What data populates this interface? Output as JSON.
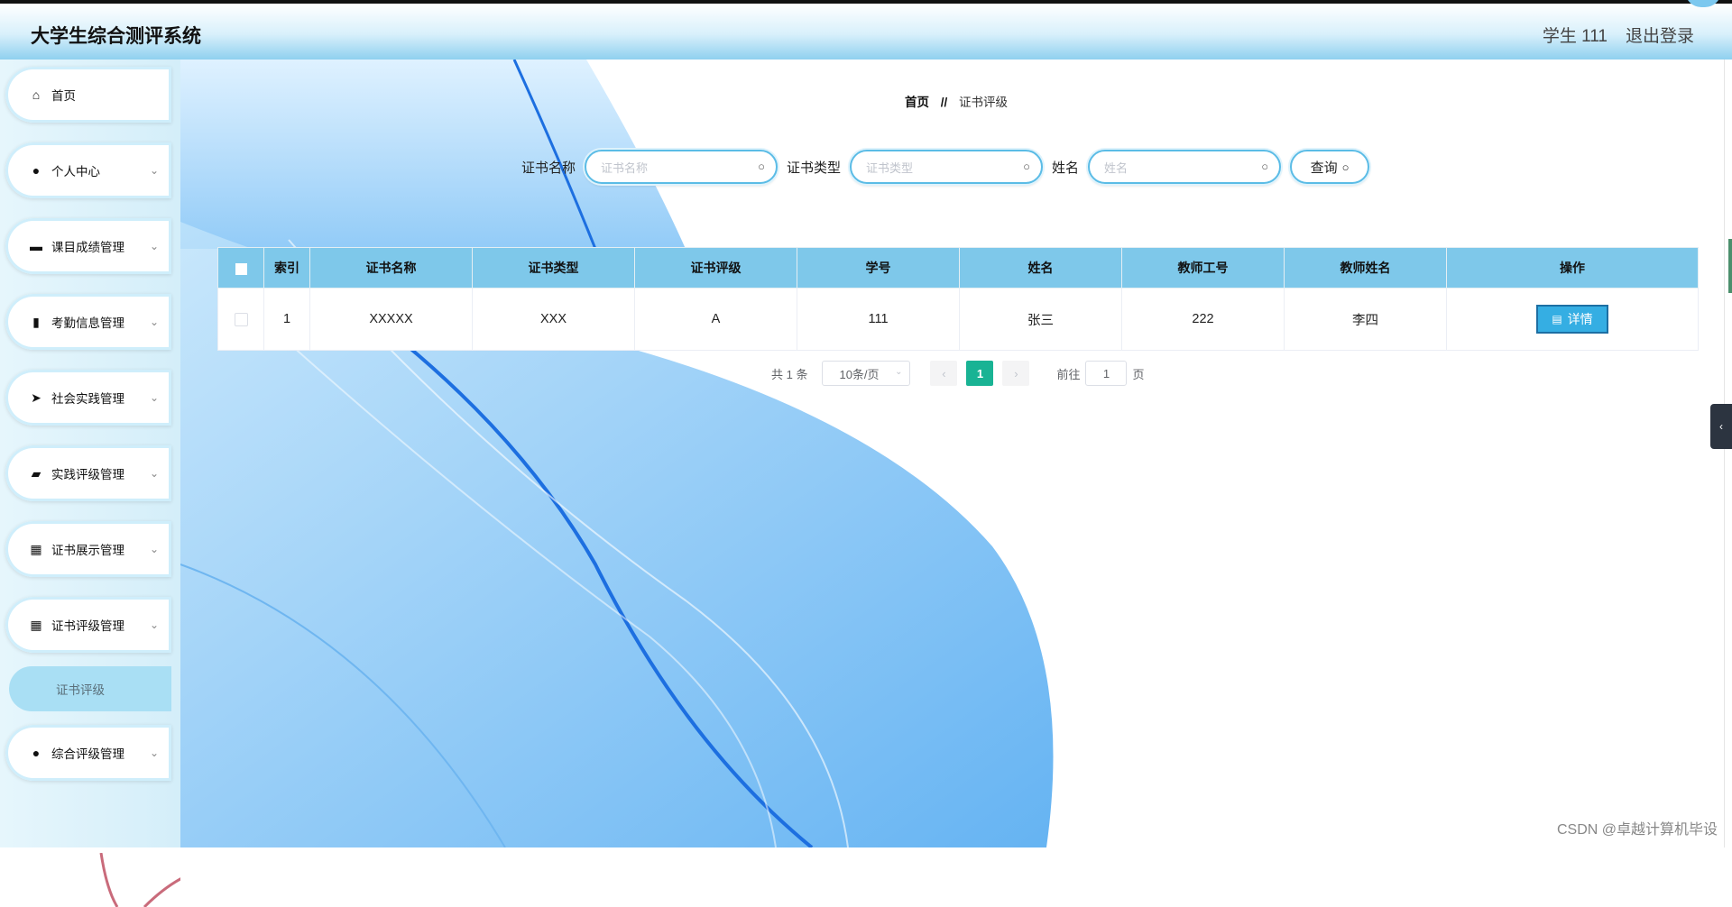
{
  "header": {
    "title": "大学生综合测评系统",
    "user": "学生 111",
    "logout": "退出登录"
  },
  "sidebar": {
    "items": [
      {
        "label": "首页",
        "icon": "home-icon",
        "glyph": "⌂",
        "has_arrow": false
      },
      {
        "label": "个人中心",
        "icon": "user-icon",
        "glyph": "●",
        "has_arrow": true
      },
      {
        "label": "课目成绩管理",
        "icon": "monitor-icon",
        "glyph": "▬",
        "has_arrow": true
      },
      {
        "label": "考勤信息管理",
        "icon": "clipboard-icon",
        "glyph": "▮",
        "has_arrow": true
      },
      {
        "label": "社会实践管理",
        "icon": "send-icon",
        "glyph": "➤",
        "has_arrow": true
      },
      {
        "label": "实践评级管理",
        "icon": "briefcase-icon",
        "glyph": "▰",
        "has_arrow": true
      },
      {
        "label": "证书展示管理",
        "icon": "grid-icon",
        "glyph": "▦",
        "has_arrow": true
      },
      {
        "label": "证书评级管理",
        "icon": "grid-icon",
        "glyph": "▦",
        "has_arrow": true
      },
      {
        "label": "综合评级管理",
        "icon": "bulb-icon",
        "glyph": "●",
        "has_arrow": true
      }
    ],
    "submenu_active": "证书评级",
    "collapse_arrow": "⌄"
  },
  "breadcrumb": {
    "home": "首页",
    "sep": "//",
    "current": "证书评级"
  },
  "search": {
    "fields": [
      {
        "label": "证书名称",
        "placeholder": "证书名称"
      },
      {
        "label": "证书类型",
        "placeholder": "证书类型"
      },
      {
        "label": "姓名",
        "placeholder": "姓名"
      }
    ],
    "button": "查询",
    "icon_glyph": "○"
  },
  "table": {
    "headers": [
      "索引",
      "证书名称",
      "证书类型",
      "证书评级",
      "学号",
      "姓名",
      "教师工号",
      "教师姓名",
      "操作"
    ],
    "rows": [
      {
        "index": "1",
        "cert_name": "XXXXX",
        "cert_type": "XXX",
        "grade": "A",
        "student_no": "111",
        "name": "张三",
        "teacher_no": "222",
        "teacher_name": "李四",
        "action": "详情"
      }
    ]
  },
  "pagination": {
    "total": "共 1 条",
    "page_size": "10条/页",
    "prev": "‹",
    "current_page": "1",
    "next": "›",
    "goto_label": "前往",
    "goto_value": "1",
    "page_suffix": "页"
  },
  "right_tab_glyph": "‹",
  "watermark": "CSDN @卓越计算机毕设",
  "colors": {
    "header_accent": "#7ec8ea",
    "primary_button": "#35aee3",
    "active_page": "#19b394"
  }
}
